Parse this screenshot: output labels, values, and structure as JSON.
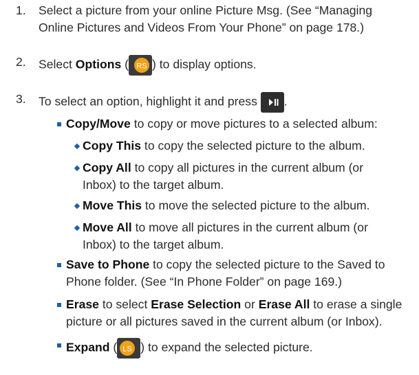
{
  "steps": [
    {
      "num": "1.",
      "l1": "Select a picture from your online Picture Msg. (See “Managing",
      "l2": "Online Pictures and Videos From Your Phone” on page 178.)"
    },
    {
      "num": "2.",
      "pre": "Select ",
      "bold": "Options",
      "open": " (",
      "icon": "RS",
      "post": ") to display options."
    },
    {
      "num": "3.",
      "text": "To select an option, highlight it and press",
      "end": "."
    }
  ],
  "bullets": {
    "copymove": {
      "bold": "Copy/Move",
      "text": " to copy or move pictures to a selected album:"
    },
    "copythis": {
      "bold": "Copy This",
      "text": " to copy the selected picture to the album."
    },
    "copyall": {
      "bold": "Copy All",
      "text": " to copy all pictures in the current album (or",
      "l2": "Inbox) to the target album."
    },
    "movethis": {
      "bold": "Move This",
      "text": " to move the selected picture to the album."
    },
    "moveall": {
      "bold": "Move All",
      "text": " to move all pictures in the current album (or",
      "l2": "Inbox) to the target album."
    },
    "save": {
      "bold": "Save to Phone",
      "text": " to copy the selected picture to the Saved to",
      "l2": "Phone folder. (See “In Phone Folder” on page 169.)"
    },
    "erase": {
      "bold": "Erase",
      "t1": " to select ",
      "bold2": "Erase Selection",
      "t2": " or ",
      "bold3": "Erase All",
      "t3": " to erase a single",
      "l2": "picture or all pictures saved in the current album (or Inbox)."
    },
    "expand": {
      "bold": "Expand",
      "open": " (",
      "icon": "LS",
      "post": ") to expand the selected picture."
    }
  },
  "colors": {
    "bullet": "#1f5fa8",
    "softkey": "#f0a21a",
    "key": "#2e2e2e"
  },
  "icons": {
    "softkey": "soft-key-icon",
    "play": "play-pause-key-icon"
  }
}
